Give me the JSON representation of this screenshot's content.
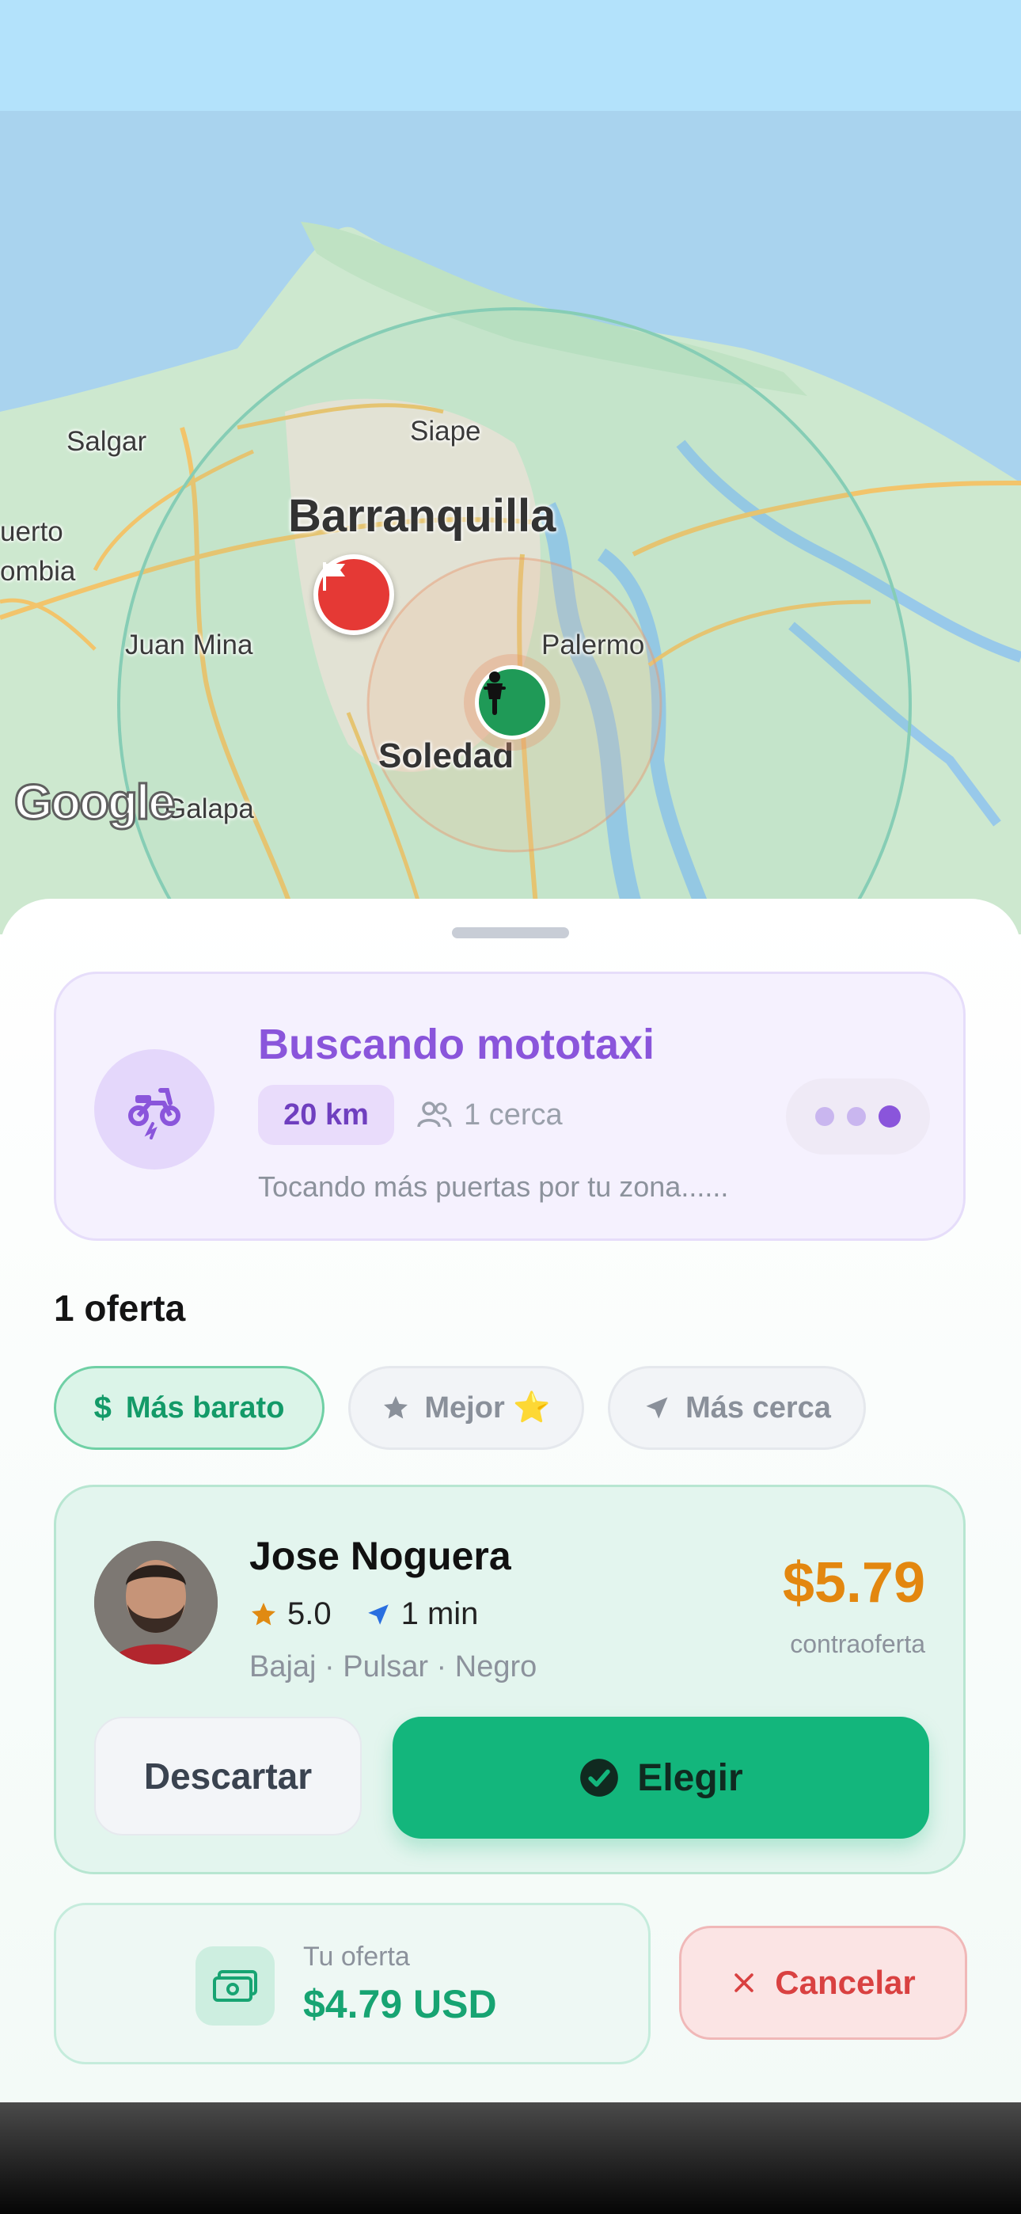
{
  "map": {
    "labels": {
      "city": "Barranquilla",
      "district": "Soledad",
      "salgar": "Salgar",
      "siape": "Siape",
      "juan_mina": "Juan Mina",
      "palermo": "Palermo",
      "galapa": "Galapa",
      "puerto": "uerto",
      "colombia": "ombia"
    },
    "attribution": "Google"
  },
  "search": {
    "title": "Buscando mototaxi",
    "radius": "20 km",
    "nearby": "1 cerca",
    "subtitle": "Tocando más puertas por tu zona......"
  },
  "offers": {
    "count_label": "1 oferta",
    "filters": [
      {
        "icon": "$",
        "label": "Más barato",
        "selected": true
      },
      {
        "icon": "star-icon",
        "label": "Mejor ⭐",
        "selected": false
      },
      {
        "icon": "navigation-icon",
        "label": "Más cerca",
        "selected": false
      }
    ],
    "items": [
      {
        "driver_name": "Jose Noguera",
        "rating": "5.0",
        "eta": "1 min",
        "vehicle": "Bajaj · Pulsar · Negro",
        "price": "$5.79",
        "price_note": "contraoferta",
        "discard_label": "Descartar",
        "choose_label": "Elegir"
      }
    ]
  },
  "my_offer": {
    "label": "Tu oferta",
    "value": "$4.79 USD"
  },
  "cancel_label": "Cancelar",
  "colors": {
    "accent_purple": "#8a55db",
    "accent_green": "#13b67c",
    "price_orange": "#e3870f",
    "cancel_red": "#d94141"
  }
}
